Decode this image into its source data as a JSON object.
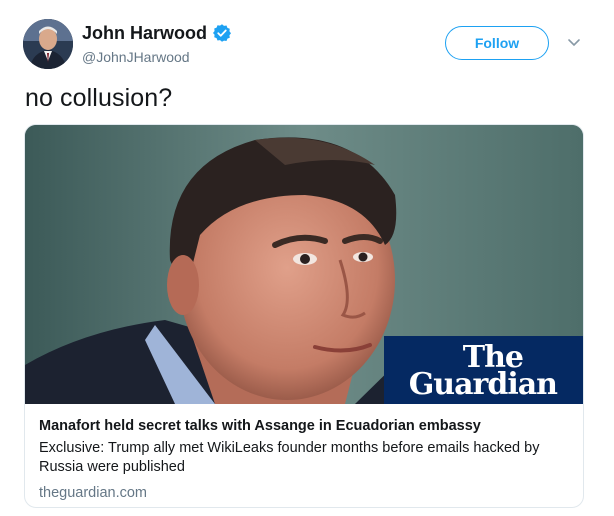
{
  "author": {
    "display_name": "John Harwood",
    "handle": "@JohnJHarwood",
    "verified": true,
    "avatar_icon": "profile-photo"
  },
  "follow_button": {
    "label": "Follow",
    "color": "#1da1f2"
  },
  "menu_icon": "chevron-down-icon",
  "tweet_text": "no collusion?",
  "card": {
    "image_description_icon": "news-photo",
    "logo": {
      "line1": "The",
      "line2": "Guardian",
      "background": "#052962"
    },
    "title": "Manafort held secret talks with Assange in Ecuadorian embassy",
    "description": "Exclusive: Trump ally met WikiLeaks founder months before emails hacked by Russia were published",
    "domain": "theguardian.com"
  }
}
